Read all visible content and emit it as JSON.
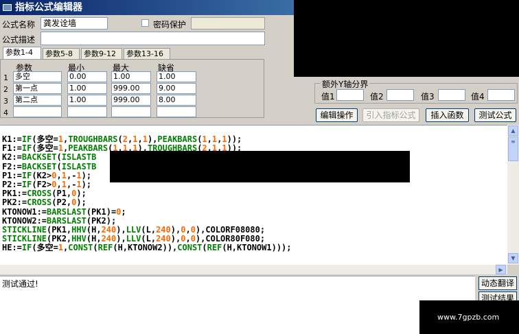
{
  "window": {
    "title": "指标公式编辑器"
  },
  "form": {
    "name_label": "公式名称",
    "name_value": "龚发诠墙",
    "password_label": "密码保护",
    "desc_label": "公式描述",
    "desc_value": ""
  },
  "tabs": [
    "参数1-4",
    "参数5-8",
    "参数9-12",
    "参数13-16"
  ],
  "params": {
    "headers": [
      "参数",
      "最小",
      "最大",
      "缺省"
    ],
    "rows": [
      {
        "num": "1",
        "name": "多空",
        "min": "0.00",
        "max": "1.00",
        "default": "1.00"
      },
      {
        "num": "2",
        "name": "第一点",
        "min": "1.00",
        "max": "999.00",
        "default": "9.00"
      },
      {
        "num": "3",
        "name": "第二点",
        "min": "1.00",
        "max": "999.00",
        "default": "8.00"
      },
      {
        "num": "4",
        "name": "",
        "min": "",
        "max": "",
        "default": ""
      }
    ]
  },
  "y_axis": {
    "title": "额外Y轴分界",
    "labels": [
      "值1",
      "值2",
      "值3",
      "值4"
    ]
  },
  "buttons": {
    "edit": "编辑操作",
    "import": "引入指标公式",
    "insert_func": "插入函数",
    "test": "测试公式"
  },
  "code_lines": [
    "K1:=IF(多空=1,TROUGHBARS(2,1,1),PEAKBARS(1,1,1));",
    "F1:=IF(多空=1,PEAKBARS(1,1,1),TROUGHBARS(2,1,1));",
    "K2:=BACKSET(ISLASTB",
    "F2:=BACKSET(ISLASTB",
    "P1:=IF(K2>0,1,-1);",
    "P2:=IF(F2>0,1,-1);",
    "PK1:=CROSS(P1,0);",
    "PK2:=CROSS(P2,0);",
    "KTONOW1:=BARSLAST(PK1)=0;",
    "KTONOW2:=BARSLAST(PK2);",
    "STICKLINE(PK1,HHV(H,240),LLV(L,240),0,0),COLORF08080;",
    "STICKLINE(PK2,HHV(H,240),LLV(L,240),0,0),COLOR80F080;",
    "HE:=IF(多空=1,CONST(REF(H,KTONOW2)),CONST(REF(H,KTONOW1)));"
  ],
  "output": {
    "text": "测试通过!"
  },
  "side_buttons": [
    "动态翻译",
    "测试结果"
  ],
  "watermark": "www.7gpzb.com"
}
